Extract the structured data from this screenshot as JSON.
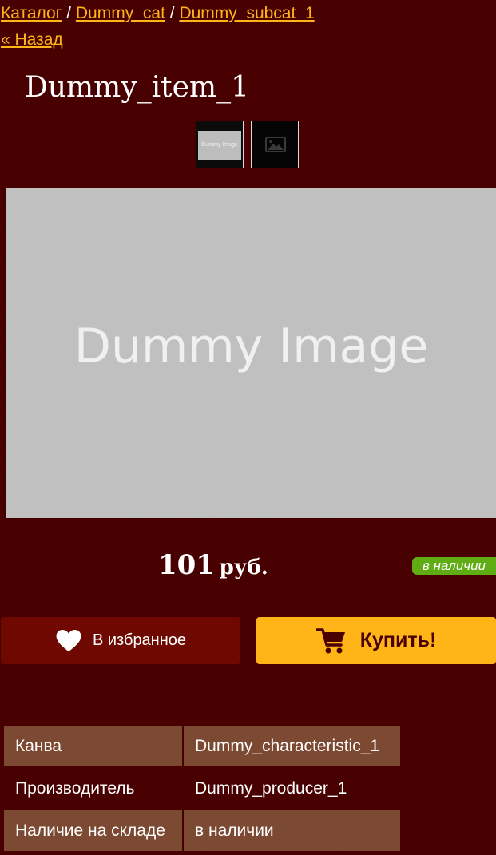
{
  "breadcrumb": {
    "items": [
      "Каталог",
      "Dummy_cat",
      "Dummy_subcat_1"
    ],
    "separator": "/"
  },
  "back_link": "« Назад",
  "product": {
    "title": "Dummy_item_1",
    "thumbnails": [
      {
        "label": "Dummy Image",
        "icon": "image-placeholder"
      },
      {
        "label": "",
        "icon": "image-icon"
      }
    ],
    "main_image_text": "Dummy Image",
    "price": {
      "value": "101",
      "currency": "руб."
    },
    "stock_badge": "в наличии"
  },
  "actions": {
    "favorite_label": "В избранное",
    "favorite_icon": "heart-icon",
    "buy_label": "Купить!",
    "buy_icon": "cart-icon"
  },
  "specs": [
    {
      "key": "Канва",
      "value": "Dummy_characteristic_1"
    },
    {
      "key": "Производитель",
      "value": "Dummy_producer_1"
    },
    {
      "key": "Наличие на складе",
      "value": "в наличии"
    }
  ],
  "colors": {
    "background": "#4a0000",
    "accent": "#ffb517",
    "favorite_button": "#6e0800",
    "stock_badge": "#5fac14",
    "table_row": "#7c4a33"
  }
}
